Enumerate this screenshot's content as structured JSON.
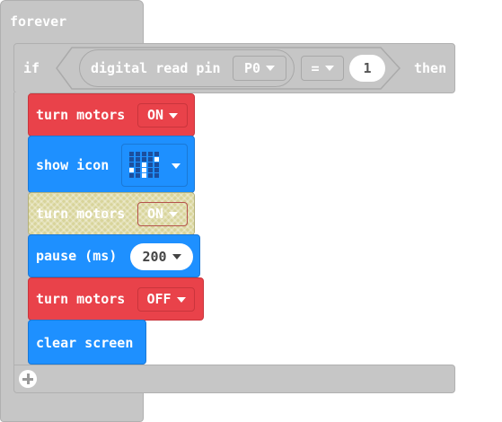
{
  "forever": {
    "label": "forever"
  },
  "if_block": {
    "if_label": "if",
    "then_label": "then"
  },
  "condition": {
    "reporter_label": "digital read pin",
    "pin_value": "P0",
    "operator": "=",
    "compare_value": "1"
  },
  "blocks": [
    {
      "label": "turn motors",
      "value": "ON"
    },
    {
      "label": "show icon"
    },
    {
      "label": "turn motors",
      "value": "ON"
    },
    {
      "label": "pause (ms)",
      "value": "200"
    },
    {
      "label": "turn motors",
      "value": "OFF"
    },
    {
      "label": "clear screen"
    }
  ],
  "colors": {
    "motor_red": "#e9424a",
    "basic_blue": "#1e90ff",
    "logic_gray": "#c6c6c6",
    "disabled_yellow": "#d8d49a"
  },
  "icons": {
    "add": "plus-circle-icon",
    "dropdown": "dropdown-arrow-icon",
    "icon_preview": "led-grid-icon"
  }
}
